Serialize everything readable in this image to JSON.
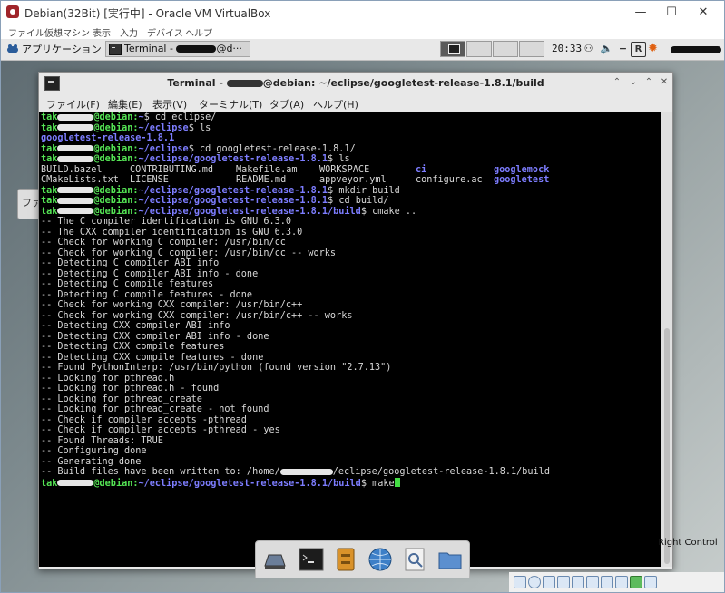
{
  "host_window": {
    "title": "Debian(32Bit) [実行中] - Oracle VM VirtualBox",
    "controls": [
      "—",
      "☐",
      "✕"
    ],
    "menu": [
      "ファイル",
      "仮想マシン",
      "表示",
      "入力",
      "デバイス",
      "ヘルプ"
    ]
  },
  "guest_panel": {
    "apps_label": "アプリケーション",
    "task_label": "Terminal - ",
    "task_suffix": "@d···",
    "clock": "20:33",
    "tray_icons": [
      "network-icon",
      "volume-icon",
      "minimize-icon",
      "r-icon",
      "settings-icon"
    ]
  },
  "bg_window": {
    "label": "ファ"
  },
  "terminal": {
    "title_prefix": "Terminal - ",
    "title_suffix": "@debian: ~/eclipse/googletest-release-1.8.1/build",
    "menu": [
      "ファイル(F)",
      "編集(E)",
      "表示(V)",
      "ターミナル(T)",
      "タブ(A)",
      "ヘルプ(H)"
    ],
    "prompt_host": "@debian",
    "user_prefix": "tak",
    "lines": [
      {
        "type": "prompt",
        "path": "~",
        "cmd": "cd eclipse/"
      },
      {
        "type": "prompt",
        "path": "~/eclipse",
        "cmd": "ls"
      },
      {
        "type": "dir",
        "text": "googletest-release-1.8.1"
      },
      {
        "type": "prompt",
        "path": "~/eclipse",
        "cmd": "cd googletest-release-1.8.1/"
      },
      {
        "type": "prompt",
        "path": "~/eclipse/googletest-release-1.8.1",
        "cmd": "ls"
      },
      {
        "type": "ls",
        "items": [
          [
            "BUILD.bazel",
            ""
          ],
          [
            "CONTRIBUTING.md",
            ""
          ],
          [
            "Makefile.am",
            ""
          ],
          [
            "WORKSPACE",
            ""
          ],
          [
            "ci",
            "dir"
          ],
          [
            "googlemock",
            "dir"
          ]
        ]
      },
      {
        "type": "ls",
        "items": [
          [
            "CMakeLists.txt",
            ""
          ],
          [
            "LICENSE",
            ""
          ],
          [
            "README.md",
            ""
          ],
          [
            "appveyor.yml",
            ""
          ],
          [
            "configure.ac",
            ""
          ],
          [
            "googletest",
            "dir"
          ]
        ]
      },
      {
        "type": "prompt",
        "path": "~/eclipse/googletest-release-1.8.1",
        "cmd": "mkdir build"
      },
      {
        "type": "prompt",
        "path": "~/eclipse/googletest-release-1.8.1",
        "cmd": "cd build/"
      },
      {
        "type": "prompt",
        "path": "~/eclipse/googletest-release-1.8.1/build",
        "cmd": "cmake .."
      },
      {
        "type": "out",
        "text": "-- The C compiler identification is GNU 6.3.0"
      },
      {
        "type": "out",
        "text": "-- The CXX compiler identification is GNU 6.3.0"
      },
      {
        "type": "out",
        "text": "-- Check for working C compiler: /usr/bin/cc"
      },
      {
        "type": "out",
        "text": "-- Check for working C compiler: /usr/bin/cc -- works"
      },
      {
        "type": "out",
        "text": "-- Detecting C compiler ABI info"
      },
      {
        "type": "out",
        "text": "-- Detecting C compiler ABI info - done"
      },
      {
        "type": "out",
        "text": "-- Detecting C compile features"
      },
      {
        "type": "out",
        "text": "-- Detecting C compile features - done"
      },
      {
        "type": "out",
        "text": "-- Check for working CXX compiler: /usr/bin/c++"
      },
      {
        "type": "out",
        "text": "-- Check for working CXX compiler: /usr/bin/c++ -- works"
      },
      {
        "type": "out",
        "text": "-- Detecting CXX compiler ABI info"
      },
      {
        "type": "out",
        "text": "-- Detecting CXX compiler ABI info - done"
      },
      {
        "type": "out",
        "text": "-- Detecting CXX compile features"
      },
      {
        "type": "out",
        "text": "-- Detecting CXX compile features - done"
      },
      {
        "type": "out",
        "text": "-- Found PythonInterp: /usr/bin/python (found version \"2.7.13\")"
      },
      {
        "type": "out",
        "text": "-- Looking for pthread.h"
      },
      {
        "type": "out",
        "text": "-- Looking for pthread.h - found"
      },
      {
        "type": "out",
        "text": "-- Looking for pthread_create"
      },
      {
        "type": "out",
        "text": "-- Looking for pthread_create - not found"
      },
      {
        "type": "out",
        "text": "-- Check if compiler accepts -pthread"
      },
      {
        "type": "out",
        "text": "-- Check if compiler accepts -pthread - yes"
      },
      {
        "type": "out",
        "text": "-- Found Threads: TRUE"
      },
      {
        "type": "out",
        "text": "-- Configuring done"
      },
      {
        "type": "out",
        "text": "-- Generating done"
      },
      {
        "type": "outr",
        "before": "-- Build files have been written to: /home/",
        "after": "/eclipse/googletest-release-1.8.1/build"
      },
      {
        "type": "prompt",
        "path": "~/eclipse/googletest-release-1.8.1/build",
        "cmd": "make",
        "cursor": true
      }
    ]
  },
  "dock": [
    "desktop-icon",
    "terminal-icon",
    "file-manager-icon",
    "web-browser-icon",
    "app-finder-icon",
    "folder-icon"
  ],
  "statusbar": {
    "host_key": "Right Control"
  },
  "colors": {
    "prompt_green": "#55e555",
    "path_blue": "#7d7dff",
    "cursor": "#44dd44"
  }
}
